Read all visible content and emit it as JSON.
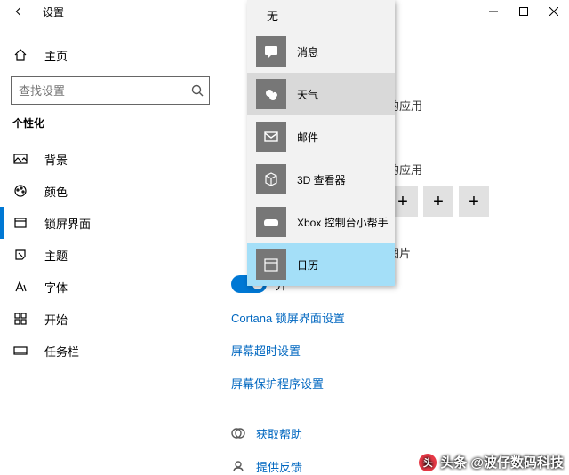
{
  "window": {
    "title": "设置"
  },
  "sidebar": {
    "home": "主页",
    "search_placeholder": "查找设置",
    "category": "个性化",
    "items": [
      {
        "label": "背景"
      },
      {
        "label": "颜色"
      },
      {
        "label": "锁屏界面"
      },
      {
        "label": "主题"
      },
      {
        "label": "字体"
      },
      {
        "label": "开始"
      },
      {
        "label": "任务栏"
      }
    ]
  },
  "dropdown": {
    "header": "无",
    "options": [
      {
        "label": "消息",
        "icon": "message"
      },
      {
        "label": "天气",
        "icon": "weather"
      },
      {
        "label": "邮件",
        "icon": "mail"
      },
      {
        "label": "3D 查看器",
        "icon": "cube"
      },
      {
        "label": "Xbox 控制台小帮手",
        "icon": "xbox"
      },
      {
        "label": "日历",
        "icon": "calendar"
      }
    ]
  },
  "main": {
    "row1_suffix": "的应用",
    "row2_suffix": "的应用",
    "row3_suffix": "图片",
    "toggle_label": "开",
    "link1": "Cortana 锁屏界面设置",
    "link2": "屏幕超时设置",
    "link3": "屏幕保护程序设置",
    "help1": "获取帮助",
    "help2": "提供反馈"
  },
  "watermark": "头条 @波仔数码科技"
}
